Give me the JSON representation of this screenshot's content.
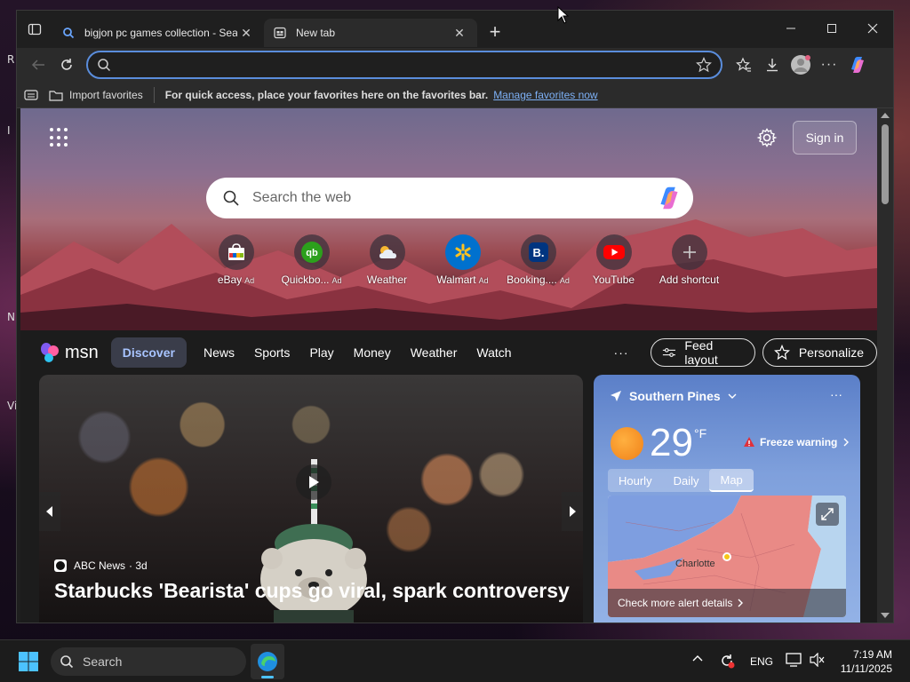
{
  "tabs": [
    {
      "title": "bigjon pc games collection - Sear",
      "active": false
    },
    {
      "title": "New tab",
      "active": true
    }
  ],
  "toolbar": {
    "address_value": ""
  },
  "favbar": {
    "import_label": "Import favorites",
    "hint": "For quick access, place your favorites here on the favorites bar.",
    "manage_link": "Manage favorites now"
  },
  "hero": {
    "signin_label": "Sign in",
    "search_placeholder": "Search the web"
  },
  "shortcuts": [
    {
      "label": "eBay",
      "ad": "Ad",
      "icon": "ebay-icon"
    },
    {
      "label": "Quickbo...",
      "ad": "Ad",
      "icon": "quickbooks-icon"
    },
    {
      "label": "Weather",
      "ad": "",
      "icon": "weather-icon"
    },
    {
      "label": "Walmart",
      "ad": "Ad",
      "icon": "walmart-icon"
    },
    {
      "label": "Booking....",
      "ad": "Ad",
      "icon": "booking-icon"
    },
    {
      "label": "YouTube",
      "ad": "",
      "icon": "youtube-icon"
    },
    {
      "label": "Add shortcut",
      "ad": "",
      "icon": "plus-icon"
    }
  ],
  "msn": {
    "logo_text": "msn",
    "nav": [
      "Discover",
      "News",
      "Sports",
      "Play",
      "Money",
      "Weather",
      "Watch"
    ],
    "more": "···",
    "feed_layout": "Feed layout",
    "personalize": "Personalize"
  },
  "news": {
    "source": "ABC News",
    "age": "· 3d",
    "headline": "Starbucks 'Bearista' cups go viral, spark controversy"
  },
  "weather": {
    "location": "Southern Pines",
    "temp": "29",
    "unit": "°F",
    "warning": "Freeze warning",
    "tabs": [
      "Hourly",
      "Daily",
      "Map"
    ],
    "active_tab": "Map",
    "map_city": "Charlotte",
    "alert_link": "Check more alert details"
  },
  "taskbar": {
    "search_label": "Search",
    "lang": "ENG",
    "time": "7:19 AM",
    "date": "11/11/2025"
  },
  "colors": {
    "accent": "#5a8ddc",
    "link": "#7db0f5",
    "msn_active": "#a8c4ff"
  }
}
